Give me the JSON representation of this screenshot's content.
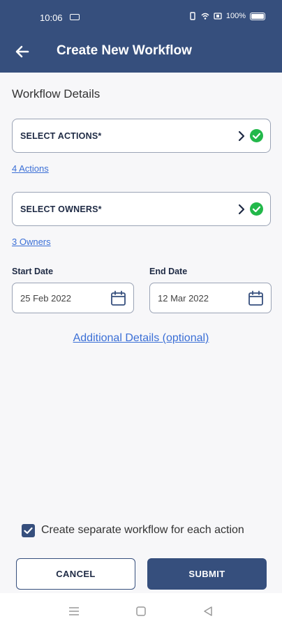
{
  "status_bar": {
    "time": "10:06",
    "battery": "100%",
    "icons": [
      "sim-icon",
      "vibrate-icon",
      "wifi-icon",
      "signal-icon",
      "battery-icon"
    ]
  },
  "app_bar": {
    "title": "Create New Workflow",
    "back_icon": "arrow-left-icon"
  },
  "form": {
    "section_title": "Workflow Details",
    "actions": {
      "label": "SELECT ACTIONS*",
      "count_link": "4 Actions",
      "status_icon": "check-circle-icon"
    },
    "owners": {
      "label": "SELECT OWNERS*",
      "count_link": "3 Owners",
      "status_icon": "check-circle-icon"
    },
    "start_date": {
      "label": "Start Date",
      "value": "25 Feb 2022"
    },
    "end_date": {
      "label": "End Date",
      "value": "12 Mar 2022"
    },
    "additional_link": "Additional Details (optional)",
    "separate_checkbox": {
      "label": "Create separate workflow for each action",
      "checked": true
    }
  },
  "buttons": {
    "cancel": "CANCEL",
    "submit": "SUBMIT"
  },
  "nav_bar": {
    "icons": [
      "menu-icon",
      "home-icon",
      "back-triangle-icon"
    ]
  },
  "colors": {
    "primary": "#364f7d",
    "link": "#3b6fd6",
    "success": "#22b84a",
    "background": "#f7f7f9"
  }
}
